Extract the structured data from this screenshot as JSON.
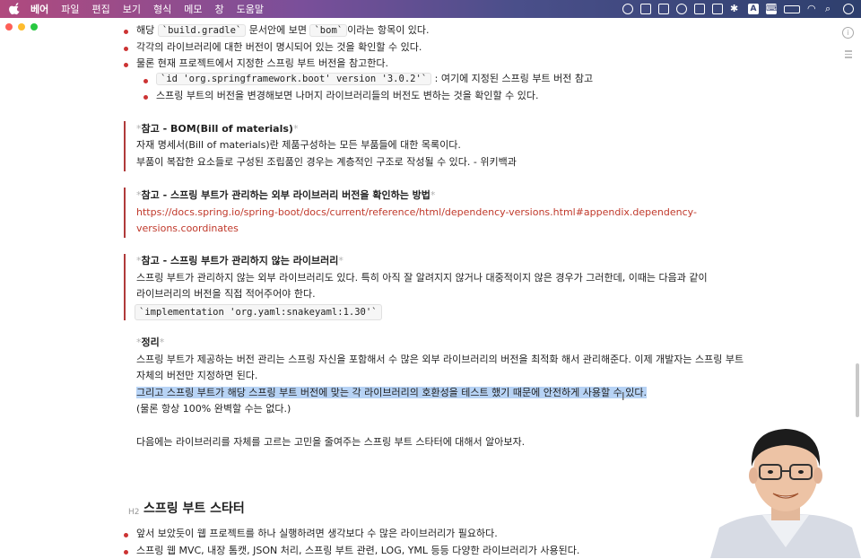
{
  "menubar": {
    "items": [
      "베어",
      "파일",
      "편집",
      "보기",
      "형식",
      "메모",
      "창",
      "도움말"
    ]
  },
  "window": {
    "bullets_top": [
      {
        "prefix": "해당 ",
        "code1": "`build.gradle`",
        "mid": " 문서안에 보면 ",
        "code2": "`bom`",
        "suffix": "이라는 항목이 있다."
      },
      {
        "text": "각각의 라이브러리에 대한 버전이 명시되어 있는 것을 확인할 수 있다."
      },
      {
        "text": "물론 현재 프로젝트에서 지정한 스프링 부트 버전을 참고한다."
      }
    ],
    "sub_bullets": [
      {
        "code": "`id 'org.springframework.boot' version '3.0.2'`",
        "suffix": " : 여기에 지정된 스프링 부트 버전 참고"
      },
      {
        "text": "스프링 부트의 버전을 변경해보면 나머지 라이브러리들의 버전도 변하는 것을 확인할 수 있다."
      }
    ],
    "quote1": {
      "title_pre": "*",
      "title": "참고 - BOM(Bill of materials)",
      "title_post": "*",
      "lines": [
        "자재 명세서(Bill of materials)란 제품구성하는 모든 부품들에 대한 목록이다.",
        "부품이 복잡한 요소들로 구성된 조립품인 경우는 계층적인 구조로 작성될 수 있다. - 위키백과"
      ]
    },
    "quote2": {
      "title_pre": "*",
      "title": "참고 - 스프링 부트가 관리하는 외부 라이브러리 버전을 확인하는 방법",
      "title_post": "*",
      "link1": "https://docs.spring.io/spring-boot/docs/current/reference/html/dependency-versions.html#appendix.dependency-",
      "link2": "versions.coordinates"
    },
    "quote3": {
      "title_pre": "*",
      "title": "참고 - 스프링 부트가 관리하지 않는 라이브러리",
      "title_post": "*",
      "lines": [
        "스프링 부트가 관리하지 않는 외부 라이브러리도 있다. 특히 아직 잘 알려지지 않거나 대중적이지 않은 경우가 그러한데, 이때는 다음과 같이",
        "라이브러리의 버전을 직접 적어주어야 한다."
      ],
      "code": "`implementation 'org.yaml:snakeyaml:1.30'`"
    },
    "summary": {
      "title_pre": "*",
      "title": "정리",
      "title_post": "*",
      "line1": "스프링 부트가 제공하는 버전 관리는 스프링 자신을 포함해서 수 많은 외부 라이브러리의 버전을 최적화 해서 관리해준다. 이제 개발자는 스프링 부트",
      "line2": "자체의 버전만 지정하면 된다.",
      "highlight": "그리고 스프링 부트가 해당 스프링 부트 버전에 맞는 각 라이브러리의 호환성을 테스트 했기 때문에 안전하게 사용할 수 있다.",
      "line4": "(물론 항상 100% 완벽할 수는 없다.)"
    },
    "next": "다음에는 라이브러리를 자체를 고르는 고민을 줄여주는 스프링 부트 스타터에 대해서 알아보자.",
    "heading": {
      "tag": "H2",
      "text": "스프링 부트 스타터"
    },
    "bullets_bottom": [
      "앞서 보았듯이 웹 프로젝트를 하나 실행하려면 생각보다 수 많은 라이브러리가 필요하다.",
      "스프링 웹 MVC, 내장 톰캣, JSON 처리, 스프링 부트 관련, LOG, YML 등등 다양한 라이브러리가 사용된다."
    ]
  },
  "colors": {
    "bullet": "#cc3333",
    "quote_bar": "#b03a3a",
    "link": "#c0392b",
    "highlight": "#b7d3f5"
  }
}
